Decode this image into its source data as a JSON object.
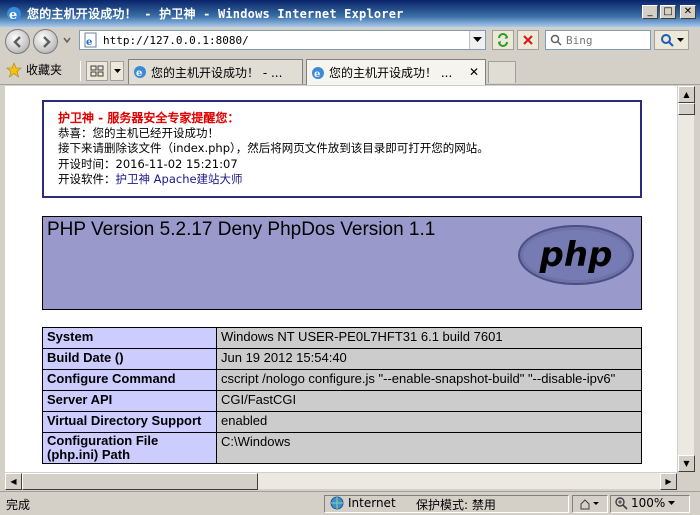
{
  "window": {
    "title": "您的主机开设成功！ - 护卫神 - Windows Internet Explorer"
  },
  "address_bar": {
    "url": "http://127.0.0.1:8080/"
  },
  "search": {
    "placeholder": "Bing"
  },
  "favorites": {
    "label": "收藏夹"
  },
  "tabs": [
    {
      "label": "您的主机开设成功！ - ...",
      "active": false
    },
    {
      "label": "您的主机开设成功！ ...",
      "active": true
    }
  ],
  "notice": {
    "title": "护卫神 - 服务器安全专家提醒您：",
    "line1": "恭喜：您的主机已经开设成功！",
    "line2": "接下来请删除该文件（index.php），然后将网页文件放到该目录即可打开您的网站。",
    "line3": "开设时间：2016-11-02 15:21:07",
    "line4_prefix": "开设软件：",
    "line4_link": "护卫神 Apache建站大师"
  },
  "php_header": {
    "title": "PHP Version 5.2.17 Deny PhpDos Version 1.1",
    "logo_text": "php"
  },
  "info_table": [
    {
      "key": "System",
      "value": "Windows NT USER-PE0L7HFT31 6.1 build 7601"
    },
    {
      "key": "Build Date ()",
      "value": "Jun 19 2012 15:54:40"
    },
    {
      "key": "Configure Command",
      "value": "cscript /nologo configure.js \"--enable-snapshot-build\" \"--disable-ipv6\""
    },
    {
      "key": "Server API",
      "value": "CGI/FastCGI"
    },
    {
      "key": "Virtual Directory Support",
      "value": "enabled"
    },
    {
      "key": "Configuration File (php.ini) Path",
      "value": "C:\\Windows"
    }
  ],
  "statusbar": {
    "status": "完成",
    "zone": "Internet",
    "protected_mode": "保护模式: 禁用",
    "zoom": "100%"
  }
}
